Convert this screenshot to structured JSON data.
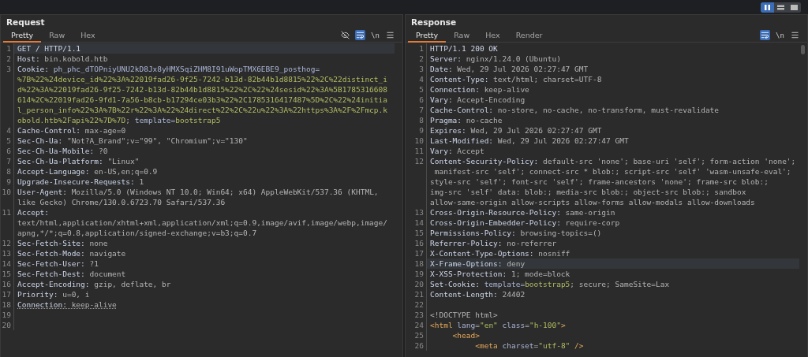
{
  "view_modes": [
    {
      "kind": "columns",
      "selected": true
    },
    {
      "kind": "rows",
      "selected": false
    },
    {
      "kind": "single",
      "selected": false
    }
  ],
  "panels": [
    {
      "title": "Request",
      "tabs": [
        {
          "label": "Pretty",
          "selected": true
        },
        {
          "label": "Raw",
          "selected": false
        },
        {
          "label": "Hex",
          "selected": false
        }
      ],
      "tools": [
        {
          "kind": "hide",
          "selected": false
        },
        {
          "kind": "wrap",
          "selected": true
        },
        {
          "kind": "newline",
          "label": "\\n",
          "selected": false
        },
        {
          "kind": "menu",
          "selected": false
        }
      ],
      "scrollbar": false,
      "lines": [
        {
          "number": "1",
          "selected": true,
          "rows": [
            [
              {
                "kind": "name",
                "text": "GET / HTTP/1.1"
              }
            ]
          ]
        },
        {
          "number": "2",
          "selected": false,
          "rows": [
            [
              {
                "kind": "name",
                "text": "Host:"
              },
              {
                "kind": "plain",
                "text": " bin.kobold.htb"
              }
            ]
          ]
        },
        {
          "number": "3",
          "selected": false,
          "rows": [
            [
              {
                "kind": "name",
                "text": "Cookie:"
              },
              {
                "kind": "cookie_name",
                "text": " ph_phc_dTOPniyUNU2kD8Jx8yHMXSqiZHM8I91uWopTMX6EBE9_posthog="
              }
            ],
            [
              {
                "kind": "cookie_value",
                "text": "%7B%22%24device_id%22%3A%22019fad26-9f25-7242-b13d-82b44b1d8815%22%2C%22distinct_i"
              }
            ],
            [
              {
                "kind": "cookie_value",
                "text": "d%22%3A%22019fad26-9f25-7242-b13d-82b44b1d8815%22%2C%22%24sesid%22%3A%5B1785316608"
              }
            ],
            [
              {
                "kind": "cookie_value",
                "text": "614%2C%22019fad26-9fd1-7a56-b8cb-b17294ce03b3%22%2C1785316417487%5D%2C%22%24initia"
              }
            ],
            [
              {
                "kind": "cookie_value",
                "text": "l_person_info%22%3A%7B%22r%22%3A%22%24direct%22%2C%22u%22%3A%22https%3A%2F%2Fmcp.k"
              }
            ],
            [
              {
                "kind": "cookie_value",
                "text": "obold.htb%2Fapi%22%7D%7D"
              },
              {
                "kind": "plain",
                "text": ";"
              },
              {
                "kind": "cookie_name",
                "text": " template="
              },
              {
                "kind": "cookie_value",
                "text": "bootstrap5"
              }
            ]
          ]
        },
        {
          "number": "4",
          "selected": false,
          "rows": [
            [
              {
                "kind": "name",
                "text": "Cache-Control:"
              },
              {
                "kind": "plain",
                "text": " max-age=0"
              }
            ]
          ]
        },
        {
          "number": "5",
          "selected": false,
          "rows": [
            [
              {
                "kind": "name",
                "text": "Sec-Ch-Ua:"
              },
              {
                "kind": "plain",
                "text": " \"Not?A_Brand\";v=\"99\", \"Chromium\";v=\"130\""
              }
            ]
          ]
        },
        {
          "number": "6",
          "selected": false,
          "rows": [
            [
              {
                "kind": "name",
                "text": "Sec-Ch-Ua-Mobile:"
              },
              {
                "kind": "plain",
                "text": " ?0"
              }
            ]
          ]
        },
        {
          "number": "7",
          "selected": false,
          "rows": [
            [
              {
                "kind": "name",
                "text": "Sec-Ch-Ua-Platform:"
              },
              {
                "kind": "plain",
                "text": " \"Linux\""
              }
            ]
          ]
        },
        {
          "number": "8",
          "selected": false,
          "rows": [
            [
              {
                "kind": "name",
                "text": "Accept-Language:"
              },
              {
                "kind": "plain",
                "text": " en-US,en;q=0.9"
              }
            ]
          ]
        },
        {
          "number": "9",
          "selected": false,
          "rows": [
            [
              {
                "kind": "name",
                "text": "Upgrade-Insecure-Requests:"
              },
              {
                "kind": "plain",
                "text": " 1"
              }
            ]
          ]
        },
        {
          "number": "10",
          "selected": false,
          "rows": [
            [
              {
                "kind": "name",
                "text": "User-Agent:"
              },
              {
                "kind": "plain",
                "text": " Mozilla/5.0 (Windows NT 10.0; Win64; x64) AppleWebKit/537.36 (KHTML,"
              }
            ],
            [
              {
                "kind": "plain",
                "text": "like Gecko) Chrome/130.0.6723.70 Safari/537.36"
              }
            ]
          ]
        },
        {
          "number": "11",
          "selected": false,
          "rows": [
            [
              {
                "kind": "name",
                "text": "Accept:"
              }
            ],
            [
              {
                "kind": "plain",
                "text": "text/html,application/xhtml+xml,application/xml;q=0.9,image/avif,image/webp,image/"
              }
            ],
            [
              {
                "kind": "plain",
                "text": "apng,*/*;q=0.8,application/signed-exchange;v=b3;q=0.7"
              }
            ]
          ]
        },
        {
          "number": "12",
          "selected": false,
          "rows": [
            [
              {
                "kind": "name",
                "text": "Sec-Fetch-Site:"
              },
              {
                "kind": "plain",
                "text": " none"
              }
            ]
          ]
        },
        {
          "number": "13",
          "selected": false,
          "rows": [
            [
              {
                "kind": "name",
                "text": "Sec-Fetch-Mode:"
              },
              {
                "kind": "plain",
                "text": " navigate"
              }
            ]
          ]
        },
        {
          "number": "14",
          "selected": false,
          "rows": [
            [
              {
                "kind": "name",
                "text": "Sec-Fetch-User:"
              },
              {
                "kind": "plain",
                "text": " ?1"
              }
            ]
          ]
        },
        {
          "number": "15",
          "selected": false,
          "rows": [
            [
              {
                "kind": "name",
                "text": "Sec-Fetch-Dest:"
              },
              {
                "kind": "plain",
                "text": " document"
              }
            ]
          ]
        },
        {
          "number": "16",
          "selected": false,
          "rows": [
            [
              {
                "kind": "name",
                "text": "Accept-Encoding:"
              },
              {
                "kind": "plain",
                "text": " gzip, deflate, br"
              }
            ]
          ]
        },
        {
          "number": "17",
          "selected": false,
          "rows": [
            [
              {
                "kind": "name",
                "text": "Priority:"
              },
              {
                "kind": "plain",
                "text": " u=0, i"
              }
            ]
          ]
        },
        {
          "number": "18",
          "selected": false,
          "rows": [
            [
              {
                "kind": "name_dotted",
                "text": "Connection:"
              },
              {
                "kind": "plain_dotted",
                "text": " keep-alive"
              }
            ]
          ]
        },
        {
          "number": "19",
          "selected": false,
          "rows": [
            []
          ]
        },
        {
          "number": "20",
          "selected": false,
          "rows": [
            []
          ]
        }
      ]
    },
    {
      "title": "Response",
      "tabs": [
        {
          "label": "Pretty",
          "selected": true
        },
        {
          "label": "Raw",
          "selected": false
        },
        {
          "label": "Hex",
          "selected": false
        },
        {
          "label": "Render",
          "selected": false
        }
      ],
      "tools": [
        {
          "kind": "wrap",
          "selected": true
        },
        {
          "kind": "newline",
          "label": "\\n",
          "selected": false
        },
        {
          "kind": "menu",
          "selected": false
        }
      ],
      "scrollbar": true,
      "lines": [
        {
          "number": "1",
          "selected": false,
          "rows": [
            [
              {
                "kind": "name",
                "text": "HTTP/1.1 200 OK"
              }
            ]
          ]
        },
        {
          "number": "2",
          "selected": false,
          "rows": [
            [
              {
                "kind": "name",
                "text": "Server:"
              },
              {
                "kind": "plain",
                "text": " nginx/1.24.0 (Ubuntu)"
              }
            ]
          ]
        },
        {
          "number": "3",
          "selected": false,
          "rows": [
            [
              {
                "kind": "name",
                "text": "Date:"
              },
              {
                "kind": "plain",
                "text": " Wed, 29 Jul 2026 02:27:47 GMT"
              }
            ]
          ]
        },
        {
          "number": "4",
          "selected": false,
          "rows": [
            [
              {
                "kind": "name",
                "text": "Content-Type:"
              },
              {
                "kind": "plain",
                "text": " text/html; charset=UTF-8"
              }
            ]
          ]
        },
        {
          "number": "5",
          "selected": false,
          "rows": [
            [
              {
                "kind": "name",
                "text": "Connection:"
              },
              {
                "kind": "plain",
                "text": " keep-alive"
              }
            ]
          ]
        },
        {
          "number": "6",
          "selected": false,
          "rows": [
            [
              {
                "kind": "name",
                "text": "Vary:"
              },
              {
                "kind": "plain",
                "text": " Accept-Encoding"
              }
            ]
          ]
        },
        {
          "number": "7",
          "selected": false,
          "rows": [
            [
              {
                "kind": "name",
                "text": "Cache-Control:"
              },
              {
                "kind": "plain",
                "text": " no-store, no-cache, no-transform, must-revalidate"
              }
            ]
          ]
        },
        {
          "number": "8",
          "selected": false,
          "rows": [
            [
              {
                "kind": "name",
                "text": "Pragma:"
              },
              {
                "kind": "plain",
                "text": " no-cache"
              }
            ]
          ]
        },
        {
          "number": "9",
          "selected": false,
          "rows": [
            [
              {
                "kind": "name",
                "text": "Expires:"
              },
              {
                "kind": "plain",
                "text": " Wed, 29 Jul 2026 02:27:47 GMT"
              }
            ]
          ]
        },
        {
          "number": "10",
          "selected": false,
          "rows": [
            [
              {
                "kind": "name",
                "text": "Last-Modified:"
              },
              {
                "kind": "plain",
                "text": " Wed, 29 Jul 2026 02:27:47 GMT"
              }
            ]
          ]
        },
        {
          "number": "11",
          "selected": false,
          "rows": [
            [
              {
                "kind": "name",
                "text": "Vary:"
              },
              {
                "kind": "plain",
                "text": " Accept"
              }
            ]
          ]
        },
        {
          "number": "12",
          "selected": false,
          "rows": [
            [
              {
                "kind": "name",
                "text": "Content-Security-Policy:"
              },
              {
                "kind": "plain",
                "text": " default-src 'none'; base-uri 'self'; form-action 'none';"
              }
            ],
            [
              {
                "kind": "plain",
                "text": " manifest-src 'self'; connect-src * blob:; script-src 'self' 'wasm-unsafe-eval';"
              }
            ],
            [
              {
                "kind": "plain",
                "text": "style-src 'self'; font-src 'self'; frame-ancestors 'none'; frame-src blob:;"
              }
            ],
            [
              {
                "kind": "plain",
                "text": "img-src 'self' data: blob:; media-src blob:; object-src blob:; sandbox"
              }
            ],
            [
              {
                "kind": "plain",
                "text": "allow-same-origin allow-scripts allow-forms allow-modals allow-downloads"
              }
            ]
          ]
        },
        {
          "number": "13",
          "selected": false,
          "rows": [
            [
              {
                "kind": "name",
                "text": "Cross-Origin-Resource-Policy:"
              },
              {
                "kind": "plain",
                "text": " same-origin"
              }
            ]
          ]
        },
        {
          "number": "14",
          "selected": false,
          "rows": [
            [
              {
                "kind": "name",
                "text": "Cross-Origin-Embedder-Policy:"
              },
              {
                "kind": "plain",
                "text": " require-corp"
              }
            ]
          ]
        },
        {
          "number": "15",
          "selected": false,
          "rows": [
            [
              {
                "kind": "name",
                "text": "Permissions-Policy:"
              },
              {
                "kind": "plain",
                "text": " browsing-topics=()"
              }
            ]
          ]
        },
        {
          "number": "16",
          "selected": false,
          "rows": [
            [
              {
                "kind": "name",
                "text": "Referrer-Policy:"
              },
              {
                "kind": "plain",
                "text": " no-referrer"
              }
            ]
          ]
        },
        {
          "number": "17",
          "selected": false,
          "rows": [
            [
              {
                "kind": "name",
                "text": "X-Content-Type-Options:"
              },
              {
                "kind": "plain",
                "text": " nosniff"
              }
            ]
          ]
        },
        {
          "number": "18",
          "selected": true,
          "rows": [
            [
              {
                "kind": "name",
                "text": "X-Frame-Options:"
              },
              {
                "kind": "plain",
                "text": " deny"
              }
            ]
          ]
        },
        {
          "number": "19",
          "selected": false,
          "rows": [
            [
              {
                "kind": "name",
                "text": "X-XSS-Protection:"
              },
              {
                "kind": "plain",
                "text": " 1; mode=block"
              }
            ]
          ]
        },
        {
          "number": "20",
          "selected": false,
          "rows": [
            [
              {
                "kind": "name",
                "text": "Set-Cookie:"
              },
              {
                "kind": "cookie_name",
                "text": " template="
              },
              {
                "kind": "cookie_value",
                "text": "bootstrap5"
              },
              {
                "kind": "plain",
                "text": "; secure; SameSite=Lax"
              }
            ]
          ]
        },
        {
          "number": "21",
          "selected": false,
          "rows": [
            [
              {
                "kind": "name",
                "text": "Content-Length:"
              },
              {
                "kind": "plain",
                "text": " 24402"
              }
            ]
          ]
        },
        {
          "number": "22",
          "selected": false,
          "rows": [
            []
          ]
        },
        {
          "number": "23",
          "selected": false,
          "rows": [
            [
              {
                "kind": "plain",
                "text": "<!DOCTYPE html>"
              }
            ]
          ]
        },
        {
          "number": "24",
          "selected": false,
          "rows": [
            [
              {
                "kind": "tag",
                "text": "<html"
              },
              {
                "kind": "attr",
                "text": " lang"
              },
              {
                "kind": "plain",
                "text": "="
              },
              {
                "kind": "string",
                "text": "\"en\""
              },
              {
                "kind": "attr",
                "text": " class"
              },
              {
                "kind": "plain",
                "text": "="
              },
              {
                "kind": "string",
                "text": "\"h-100\""
              },
              {
                "kind": "tag",
                "text": ">"
              }
            ]
          ]
        },
        {
          "number": "25",
          "selected": false,
          "rows": [
            [
              {
                "kind": "tag",
                "text": "     <head>"
              }
            ]
          ]
        },
        {
          "number": "26",
          "selected": false,
          "rows": [
            [
              {
                "kind": "tag",
                "text": "          <meta"
              },
              {
                "kind": "attr",
                "text": " charset"
              },
              {
                "kind": "plain",
                "text": "="
              },
              {
                "kind": "string",
                "text": "\"utf-8\""
              },
              {
                "kind": "tag",
                "text": " />"
              }
            ]
          ]
        }
      ]
    }
  ]
}
